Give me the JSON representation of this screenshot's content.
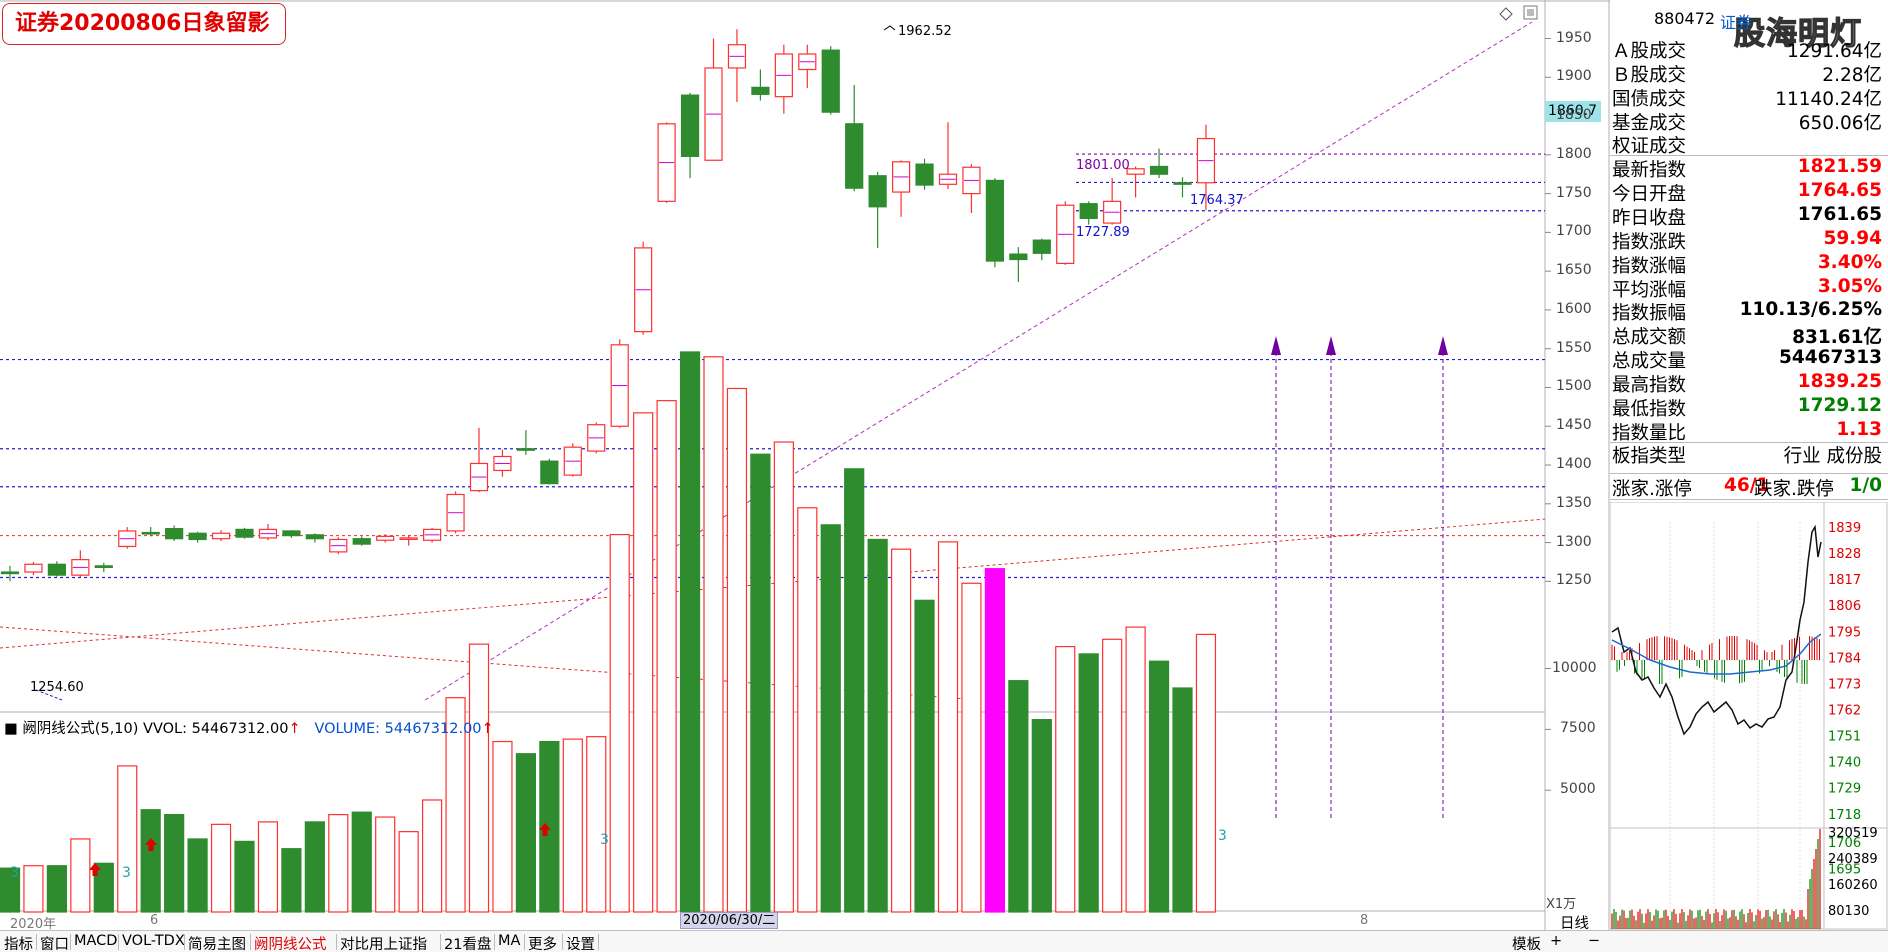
{
  "title": "证券20200806日象留影",
  "watermark": "股海明灯",
  "stock": {
    "code": "880472",
    "name": "证券"
  },
  "current_price_tag": "1860.7",
  "annotations": {
    "high": "1962.52",
    "low": "1254.60",
    "lvl1": "1801.00",
    "lvl2": "1764.37",
    "lvl3": "1727.89"
  },
  "indicator_line": {
    "name": "阙阴线公式(5,10)",
    "vvol": "VVOL: 54467312.00",
    "volume": "VOLUME: 54467312.00",
    "arrow": "↑"
  },
  "volume_unit": "X1万",
  "vol_marks": {
    "m1": "3",
    "m2": "3",
    "m3": "3",
    "m4": "3"
  },
  "dates": {
    "year": "2020年",
    "m6": "6",
    "hl": "2020/06/30/二",
    "m8": "8"
  },
  "price_ticks": [
    "1950",
    "1900",
    "1850",
    "1800",
    "1750",
    "1700",
    "1650",
    "1600",
    "1550",
    "1500",
    "1450",
    "1400",
    "1350",
    "1300",
    "1250"
  ],
  "vol_ticks": [
    "10000",
    "7500",
    "5000"
  ],
  "stats": [
    {
      "label": "Ａ股成交",
      "value": "1291.64亿",
      "color": "blk"
    },
    {
      "label": "Ｂ股成交",
      "value": "2.28亿",
      "color": "blk"
    },
    {
      "label": "国债成交",
      "value": "11140.24亿",
      "color": "blk"
    },
    {
      "label": "基金成交",
      "value": "650.06亿",
      "color": "blk"
    },
    {
      "label": "权证成交",
      "value": "",
      "color": "blk"
    },
    {
      "label": "最新指数",
      "value": "1821.59",
      "color": "red"
    },
    {
      "label": "今日开盘",
      "value": "1764.65",
      "color": "red"
    },
    {
      "label": "昨日收盘",
      "value": "1761.65",
      "color": "blk"
    },
    {
      "label": "指数涨跌",
      "value": "59.94",
      "color": "red"
    },
    {
      "label": "指数涨幅",
      "value": "3.40%",
      "color": "red"
    },
    {
      "label": "平均涨幅",
      "value": "3.05%",
      "color": "red"
    },
    {
      "label": "指数振幅",
      "value": "110.13/6.25%",
      "color": "blk"
    },
    {
      "label": "总成交额",
      "value": "831.61亿",
      "color": "blk"
    },
    {
      "label": "总成交量",
      "value": "54467313",
      "color": "blk"
    },
    {
      "label": "最高指数",
      "value": "1839.25",
      "color": "red"
    },
    {
      "label": "最低指数",
      "value": "1729.12",
      "color": "green"
    },
    {
      "label": "指数量比",
      "value": "1.13",
      "color": "red"
    },
    {
      "label": "板指类型",
      "value": "行业 成份股",
      "color": "blk"
    }
  ],
  "updown": {
    "l1": "涨家.涨停",
    "v1": "46/1",
    "l2": "跌家.跌停",
    "v2": "1/0"
  },
  "mini_chart": {
    "label": "证券",
    "price_ticks": [
      "1839",
      "1828",
      "1817",
      "1806",
      "1795",
      "1784",
      "1773",
      "1762",
      "1751",
      "1740",
      "1729",
      "1718",
      "1706",
      "1695"
    ],
    "vol_ticks": [
      "320519",
      "240389",
      "160260",
      "80130"
    ]
  },
  "tabs": [
    "指标",
    "窗口",
    "MACD",
    "VOL-TDX",
    "简易主图",
    "阙阴线公式",
    "对比用上证指",
    "21看盘",
    "MA",
    "更多",
    "设置"
  ],
  "right_tabs": {
    "template": "模板",
    "daily": "日线"
  },
  "colors": {
    "up": "#ff3030",
    "down": "#2e8b2e",
    "dashblue": "#2020d0",
    "dashred": "#e03030",
    "dashpurple": "#b030c0"
  },
  "chart_data": {
    "type": "candlestick",
    "candles": [
      {
        "o": 1262,
        "c": 1260,
        "h": 1270,
        "l": 1250,
        "v": 1800
      },
      {
        "o": 1262,
        "c": 1272,
        "h": 1275,
        "l": 1258,
        "v": 1900
      },
      {
        "o": 1272,
        "c": 1258,
        "h": 1276,
        "l": 1256,
        "v": 1900
      },
      {
        "o": 1258,
        "c": 1278,
        "h": 1290,
        "l": 1255,
        "v": 3000
      },
      {
        "o": 1270,
        "c": 1268,
        "h": 1274,
        "l": 1262,
        "v": 2000
      },
      {
        "o": 1295,
        "c": 1315,
        "h": 1320,
        "l": 1292,
        "v": 6000
      },
      {
        "o": 1313,
        "c": 1312,
        "h": 1320,
        "l": 1308,
        "v": 4200
      },
      {
        "o": 1318,
        "c": 1305,
        "h": 1322,
        "l": 1302,
        "v": 4000
      },
      {
        "o": 1312,
        "c": 1304,
        "h": 1314,
        "l": 1300,
        "v": 3000
      },
      {
        "o": 1305,
        "c": 1312,
        "h": 1316,
        "l": 1302,
        "v": 3600
      },
      {
        "o": 1317,
        "c": 1307,
        "h": 1319,
        "l": 1305,
        "v": 2900
      },
      {
        "o": 1306,
        "c": 1317,
        "h": 1324,
        "l": 1303,
        "v": 3700
      },
      {
        "o": 1315,
        "c": 1309,
        "h": 1316,
        "l": 1306,
        "v": 2600
      },
      {
        "o": 1310,
        "c": 1305,
        "h": 1312,
        "l": 1300,
        "v": 3700
      },
      {
        "o": 1288,
        "c": 1304,
        "h": 1307,
        "l": 1285,
        "v": 4000
      },
      {
        "o": 1305,
        "c": 1298,
        "h": 1308,
        "l": 1296,
        "v": 4100
      },
      {
        "o": 1303,
        "c": 1308,
        "h": 1311,
        "l": 1300,
        "v": 3900
      },
      {
        "o": 1306,
        "c": 1306,
        "h": 1310,
        "l": 1296,
        "v": 3300
      },
      {
        "o": 1303,
        "c": 1317,
        "h": 1319,
        "l": 1300,
        "v": 4600
      },
      {
        "o": 1315,
        "c": 1362,
        "h": 1366,
        "l": 1312,
        "v": 8800
      },
      {
        "o": 1367,
        "c": 1402,
        "h": 1448,
        "l": 1365,
        "v": 11000
      },
      {
        "o": 1393,
        "c": 1411,
        "h": 1420,
        "l": 1385,
        "v": 7000
      },
      {
        "o": 1421,
        "c": 1420,
        "h": 1445,
        "l": 1413,
        "v": 6500
      },
      {
        "o": 1405,
        "c": 1376,
        "h": 1408,
        "l": 1375,
        "v": 7000
      },
      {
        "o": 1387,
        "c": 1423,
        "h": 1428,
        "l": 1385,
        "v": 7100
      },
      {
        "o": 1418,
        "c": 1452,
        "h": 1455,
        "l": 1415,
        "v": 7200
      },
      {
        "o": 1450,
        "c": 1555,
        "h": 1562,
        "l": 1448,
        "v": 15500
      },
      {
        "o": 1572,
        "c": 1680,
        "h": 1688,
        "l": 1568,
        "v": 20500
      },
      {
        "o": 1740,
        "c": 1840,
        "h": 1842,
        "l": 1738,
        "v": 21000
      },
      {
        "o": 1877,
        "c": 1798,
        "h": 1880,
        "l": 1770,
        "v": 23000
      },
      {
        "o": 1793,
        "c": 1912,
        "h": 1950,
        "l": 1793,
        "v": 22800
      },
      {
        "o": 1912,
        "c": 1942,
        "h": 1962,
        "l": 1868,
        "v": 21500
      },
      {
        "o": 1887,
        "c": 1878,
        "h": 1910,
        "l": 1870,
        "v": 18800
      },
      {
        "o": 1875,
        "c": 1930,
        "h": 1942,
        "l": 1853,
        "v": 19300
      },
      {
        "o": 1910,
        "c": 1930,
        "h": 1942,
        "l": 1886,
        "v": 16600
      },
      {
        "o": 1935,
        "c": 1855,
        "h": 1940,
        "l": 1852,
        "v": 15900
      },
      {
        "o": 1840,
        "c": 1757,
        "h": 1890,
        "l": 1753,
        "v": 18200
      },
      {
        "o": 1773,
        "c": 1733,
        "h": 1778,
        "l": 1680,
        "v": 15300
      },
      {
        "o": 1752,
        "c": 1791,
        "h": 1793,
        "l": 1720,
        "v": 14900
      },
      {
        "o": 1788,
        "c": 1761,
        "h": 1795,
        "l": 1755,
        "v": 12800
      },
      {
        "o": 1762,
        "c": 1775,
        "h": 1842,
        "l": 1756,
        "v": 15200
      },
      {
        "o": 1750,
        "c": 1784,
        "h": 1788,
        "l": 1725,
        "v": 13500
      },
      {
        "o": 1767,
        "c": 1663,
        "h": 1770,
        "l": 1655,
        "v": 14100
      },
      {
        "o": 1672,
        "c": 1665,
        "h": 1681,
        "l": 1636,
        "v": 9500
      },
      {
        "o": 1690,
        "c": 1673,
        "h": 1692,
        "l": 1664,
        "v": 7900
      },
      {
        "o": 1660,
        "c": 1735,
        "h": 1740,
        "l": 1658,
        "v": 10900
      },
      {
        "o": 1737,
        "c": 1718,
        "h": 1740,
        "l": 1710,
        "v": 10600
      },
      {
        "o": 1712,
        "c": 1740,
        "h": 1770,
        "l": 1710,
        "v": 11200
      },
      {
        "o": 1775,
        "c": 1782,
        "h": 1785,
        "l": 1745,
        "v": 11700
      },
      {
        "o": 1785,
        "c": 1775,
        "h": 1808,
        "l": 1770,
        "v": 10300
      },
      {
        "o": 1764,
        "c": 1763,
        "h": 1771,
        "l": 1745,
        "v": 9200
      },
      {
        "o": 1764,
        "c": 1821,
        "h": 1839,
        "l": 1729,
        "v": 11400
      }
    ],
    "special_volume_index": 42
  }
}
